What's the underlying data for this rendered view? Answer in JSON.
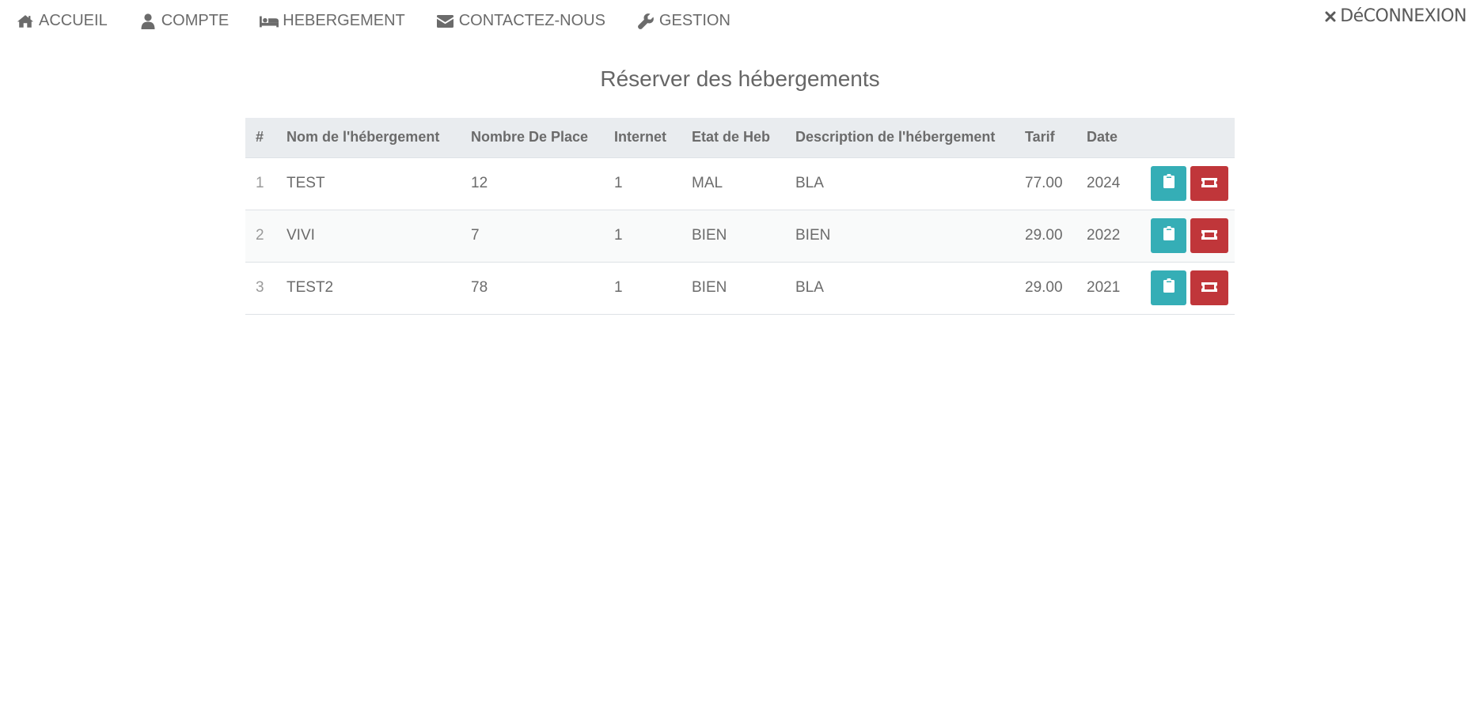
{
  "colors": {
    "book_button": "#35aeb6",
    "cancel_button": "#c0363a",
    "header_background": "#e9ecef",
    "text": "#6b6b6b"
  },
  "nav": {
    "items": [
      {
        "label": "ACCUEIL",
        "icon": "home-icon"
      },
      {
        "label": "COMPTE",
        "icon": "user-icon"
      },
      {
        "label": "HEBERGEMENT",
        "icon": "bed-icon"
      },
      {
        "label": "CONTACTEZ-NOUS",
        "icon": "envelope-icon"
      },
      {
        "label": "GESTION",
        "icon": "wrench-icon"
      }
    ],
    "logout": {
      "label": "DéCONNEXION",
      "icon": "close-icon"
    }
  },
  "page": {
    "title": "Réserver des hébergements"
  },
  "table": {
    "columns": [
      "#",
      "Nom de l'hébergement",
      "Nombre De Place",
      "Internet",
      "Etat de Heb",
      "Description de l'hébergement",
      "Tarif",
      "Date",
      ""
    ],
    "rows": [
      {
        "num": "1",
        "name": "TEST",
        "places": "12",
        "internet": "1",
        "etat": "MAL",
        "description": "BLA",
        "tarif": "77.00",
        "date": "2024",
        "book_icon": "clipboard-icon",
        "cancel_icon": "ticket-icon"
      },
      {
        "num": "2",
        "name": "VIVI",
        "places": "7",
        "internet": "1",
        "etat": "BIEN",
        "description": "BIEN",
        "tarif": "29.00",
        "date": "2022",
        "book_icon": "clipboard-icon",
        "cancel_icon": "ticket-icon"
      },
      {
        "num": "3",
        "name": "TEST2",
        "places": "78",
        "internet": "1",
        "etat": "BIEN",
        "description": "BLA",
        "tarif": "29.00",
        "date": "2021",
        "book_icon": "clipboard-icon",
        "cancel_icon": "ticket-icon"
      }
    ]
  }
}
